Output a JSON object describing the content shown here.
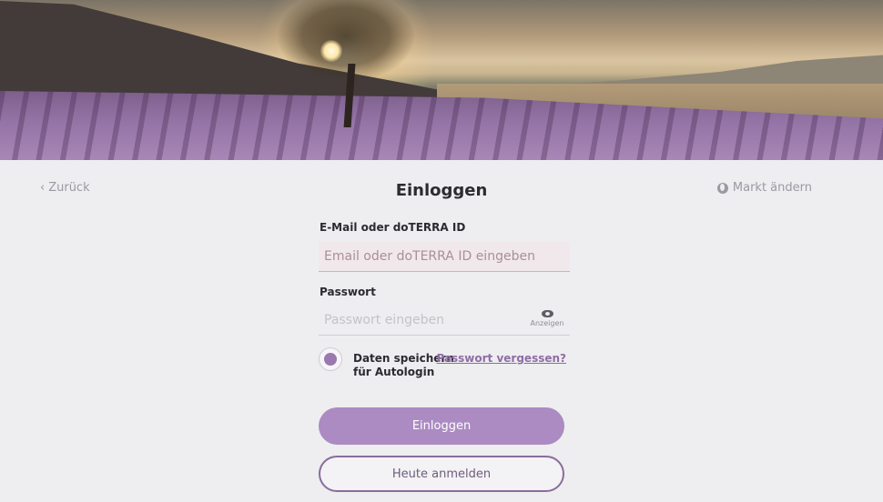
{
  "nav": {
    "back_label": "Zurück",
    "title": "Einloggen",
    "market_label": "Markt ändern"
  },
  "form": {
    "email_label": "E-Mail oder doTERRA ID",
    "email_placeholder": "Email oder doTERRA ID eingeben",
    "password_label": "Passwort",
    "password_placeholder": "Passwort eingeben",
    "show_label": "Anzeigen",
    "remember_label": "Daten speichern für Autologin",
    "remember_checked": true,
    "forgot_label": "Passwort vergessen?"
  },
  "buttons": {
    "login": "Einloggen",
    "signup": "Heute anmelden"
  },
  "icons": {
    "back": "chevron-left-icon",
    "market": "globe-icon",
    "show": "eye-icon"
  },
  "colors": {
    "accent": "#ab8bc1",
    "accent_dark": "#8a6c9c",
    "background": "#eeedf0"
  }
}
